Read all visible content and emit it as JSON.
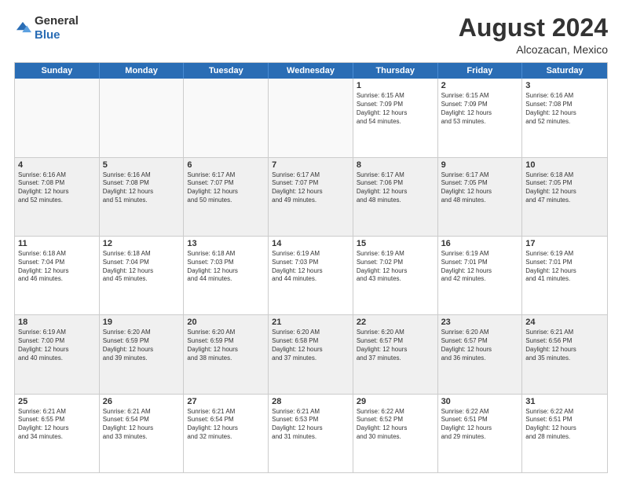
{
  "logo": {
    "general": "General",
    "blue": "Blue"
  },
  "header": {
    "month_year": "August 2024",
    "location": "Alcozacan, Mexico"
  },
  "weekdays": [
    "Sunday",
    "Monday",
    "Tuesday",
    "Wednesday",
    "Thursday",
    "Friday",
    "Saturday"
  ],
  "rows": [
    [
      {
        "day": "",
        "empty": true
      },
      {
        "day": "",
        "empty": true
      },
      {
        "day": "",
        "empty": true
      },
      {
        "day": "",
        "empty": true
      },
      {
        "day": "1",
        "lines": [
          "Sunrise: 6:15 AM",
          "Sunset: 7:09 PM",
          "Daylight: 12 hours",
          "and 54 minutes."
        ]
      },
      {
        "day": "2",
        "lines": [
          "Sunrise: 6:15 AM",
          "Sunset: 7:09 PM",
          "Daylight: 12 hours",
          "and 53 minutes."
        ]
      },
      {
        "day": "3",
        "lines": [
          "Sunrise: 6:16 AM",
          "Sunset: 7:08 PM",
          "Daylight: 12 hours",
          "and 52 minutes."
        ]
      }
    ],
    [
      {
        "day": "4",
        "lines": [
          "Sunrise: 6:16 AM",
          "Sunset: 7:08 PM",
          "Daylight: 12 hours",
          "and 52 minutes."
        ]
      },
      {
        "day": "5",
        "lines": [
          "Sunrise: 6:16 AM",
          "Sunset: 7:08 PM",
          "Daylight: 12 hours",
          "and 51 minutes."
        ]
      },
      {
        "day": "6",
        "lines": [
          "Sunrise: 6:17 AM",
          "Sunset: 7:07 PM",
          "Daylight: 12 hours",
          "and 50 minutes."
        ]
      },
      {
        "day": "7",
        "lines": [
          "Sunrise: 6:17 AM",
          "Sunset: 7:07 PM",
          "Daylight: 12 hours",
          "and 49 minutes."
        ]
      },
      {
        "day": "8",
        "lines": [
          "Sunrise: 6:17 AM",
          "Sunset: 7:06 PM",
          "Daylight: 12 hours",
          "and 48 minutes."
        ]
      },
      {
        "day": "9",
        "lines": [
          "Sunrise: 6:17 AM",
          "Sunset: 7:05 PM",
          "Daylight: 12 hours",
          "and 48 minutes."
        ]
      },
      {
        "day": "10",
        "lines": [
          "Sunrise: 6:18 AM",
          "Sunset: 7:05 PM",
          "Daylight: 12 hours",
          "and 47 minutes."
        ]
      }
    ],
    [
      {
        "day": "11",
        "lines": [
          "Sunrise: 6:18 AM",
          "Sunset: 7:04 PM",
          "Daylight: 12 hours",
          "and 46 minutes."
        ]
      },
      {
        "day": "12",
        "lines": [
          "Sunrise: 6:18 AM",
          "Sunset: 7:04 PM",
          "Daylight: 12 hours",
          "and 45 minutes."
        ]
      },
      {
        "day": "13",
        "lines": [
          "Sunrise: 6:18 AM",
          "Sunset: 7:03 PM",
          "Daylight: 12 hours",
          "and 44 minutes."
        ]
      },
      {
        "day": "14",
        "lines": [
          "Sunrise: 6:19 AM",
          "Sunset: 7:03 PM",
          "Daylight: 12 hours",
          "and 44 minutes."
        ]
      },
      {
        "day": "15",
        "lines": [
          "Sunrise: 6:19 AM",
          "Sunset: 7:02 PM",
          "Daylight: 12 hours",
          "and 43 minutes."
        ]
      },
      {
        "day": "16",
        "lines": [
          "Sunrise: 6:19 AM",
          "Sunset: 7:01 PM",
          "Daylight: 12 hours",
          "and 42 minutes."
        ]
      },
      {
        "day": "17",
        "lines": [
          "Sunrise: 6:19 AM",
          "Sunset: 7:01 PM",
          "Daylight: 12 hours",
          "and 41 minutes."
        ]
      }
    ],
    [
      {
        "day": "18",
        "lines": [
          "Sunrise: 6:19 AM",
          "Sunset: 7:00 PM",
          "Daylight: 12 hours",
          "and 40 minutes."
        ]
      },
      {
        "day": "19",
        "lines": [
          "Sunrise: 6:20 AM",
          "Sunset: 6:59 PM",
          "Daylight: 12 hours",
          "and 39 minutes."
        ]
      },
      {
        "day": "20",
        "lines": [
          "Sunrise: 6:20 AM",
          "Sunset: 6:59 PM",
          "Daylight: 12 hours",
          "and 38 minutes."
        ]
      },
      {
        "day": "21",
        "lines": [
          "Sunrise: 6:20 AM",
          "Sunset: 6:58 PM",
          "Daylight: 12 hours",
          "and 37 minutes."
        ]
      },
      {
        "day": "22",
        "lines": [
          "Sunrise: 6:20 AM",
          "Sunset: 6:57 PM",
          "Daylight: 12 hours",
          "and 37 minutes."
        ]
      },
      {
        "day": "23",
        "lines": [
          "Sunrise: 6:20 AM",
          "Sunset: 6:57 PM",
          "Daylight: 12 hours",
          "and 36 minutes."
        ]
      },
      {
        "day": "24",
        "lines": [
          "Sunrise: 6:21 AM",
          "Sunset: 6:56 PM",
          "Daylight: 12 hours",
          "and 35 minutes."
        ]
      }
    ],
    [
      {
        "day": "25",
        "lines": [
          "Sunrise: 6:21 AM",
          "Sunset: 6:55 PM",
          "Daylight: 12 hours",
          "and 34 minutes."
        ]
      },
      {
        "day": "26",
        "lines": [
          "Sunrise: 6:21 AM",
          "Sunset: 6:54 PM",
          "Daylight: 12 hours",
          "and 33 minutes."
        ]
      },
      {
        "day": "27",
        "lines": [
          "Sunrise: 6:21 AM",
          "Sunset: 6:54 PM",
          "Daylight: 12 hours",
          "and 32 minutes."
        ]
      },
      {
        "day": "28",
        "lines": [
          "Sunrise: 6:21 AM",
          "Sunset: 6:53 PM",
          "Daylight: 12 hours",
          "and 31 minutes."
        ]
      },
      {
        "day": "29",
        "lines": [
          "Sunrise: 6:22 AM",
          "Sunset: 6:52 PM",
          "Daylight: 12 hours",
          "and 30 minutes."
        ]
      },
      {
        "day": "30",
        "lines": [
          "Sunrise: 6:22 AM",
          "Sunset: 6:51 PM",
          "Daylight: 12 hours",
          "and 29 minutes."
        ]
      },
      {
        "day": "31",
        "lines": [
          "Sunrise: 6:22 AM",
          "Sunset: 6:51 PM",
          "Daylight: 12 hours",
          "and 28 minutes."
        ]
      }
    ]
  ]
}
